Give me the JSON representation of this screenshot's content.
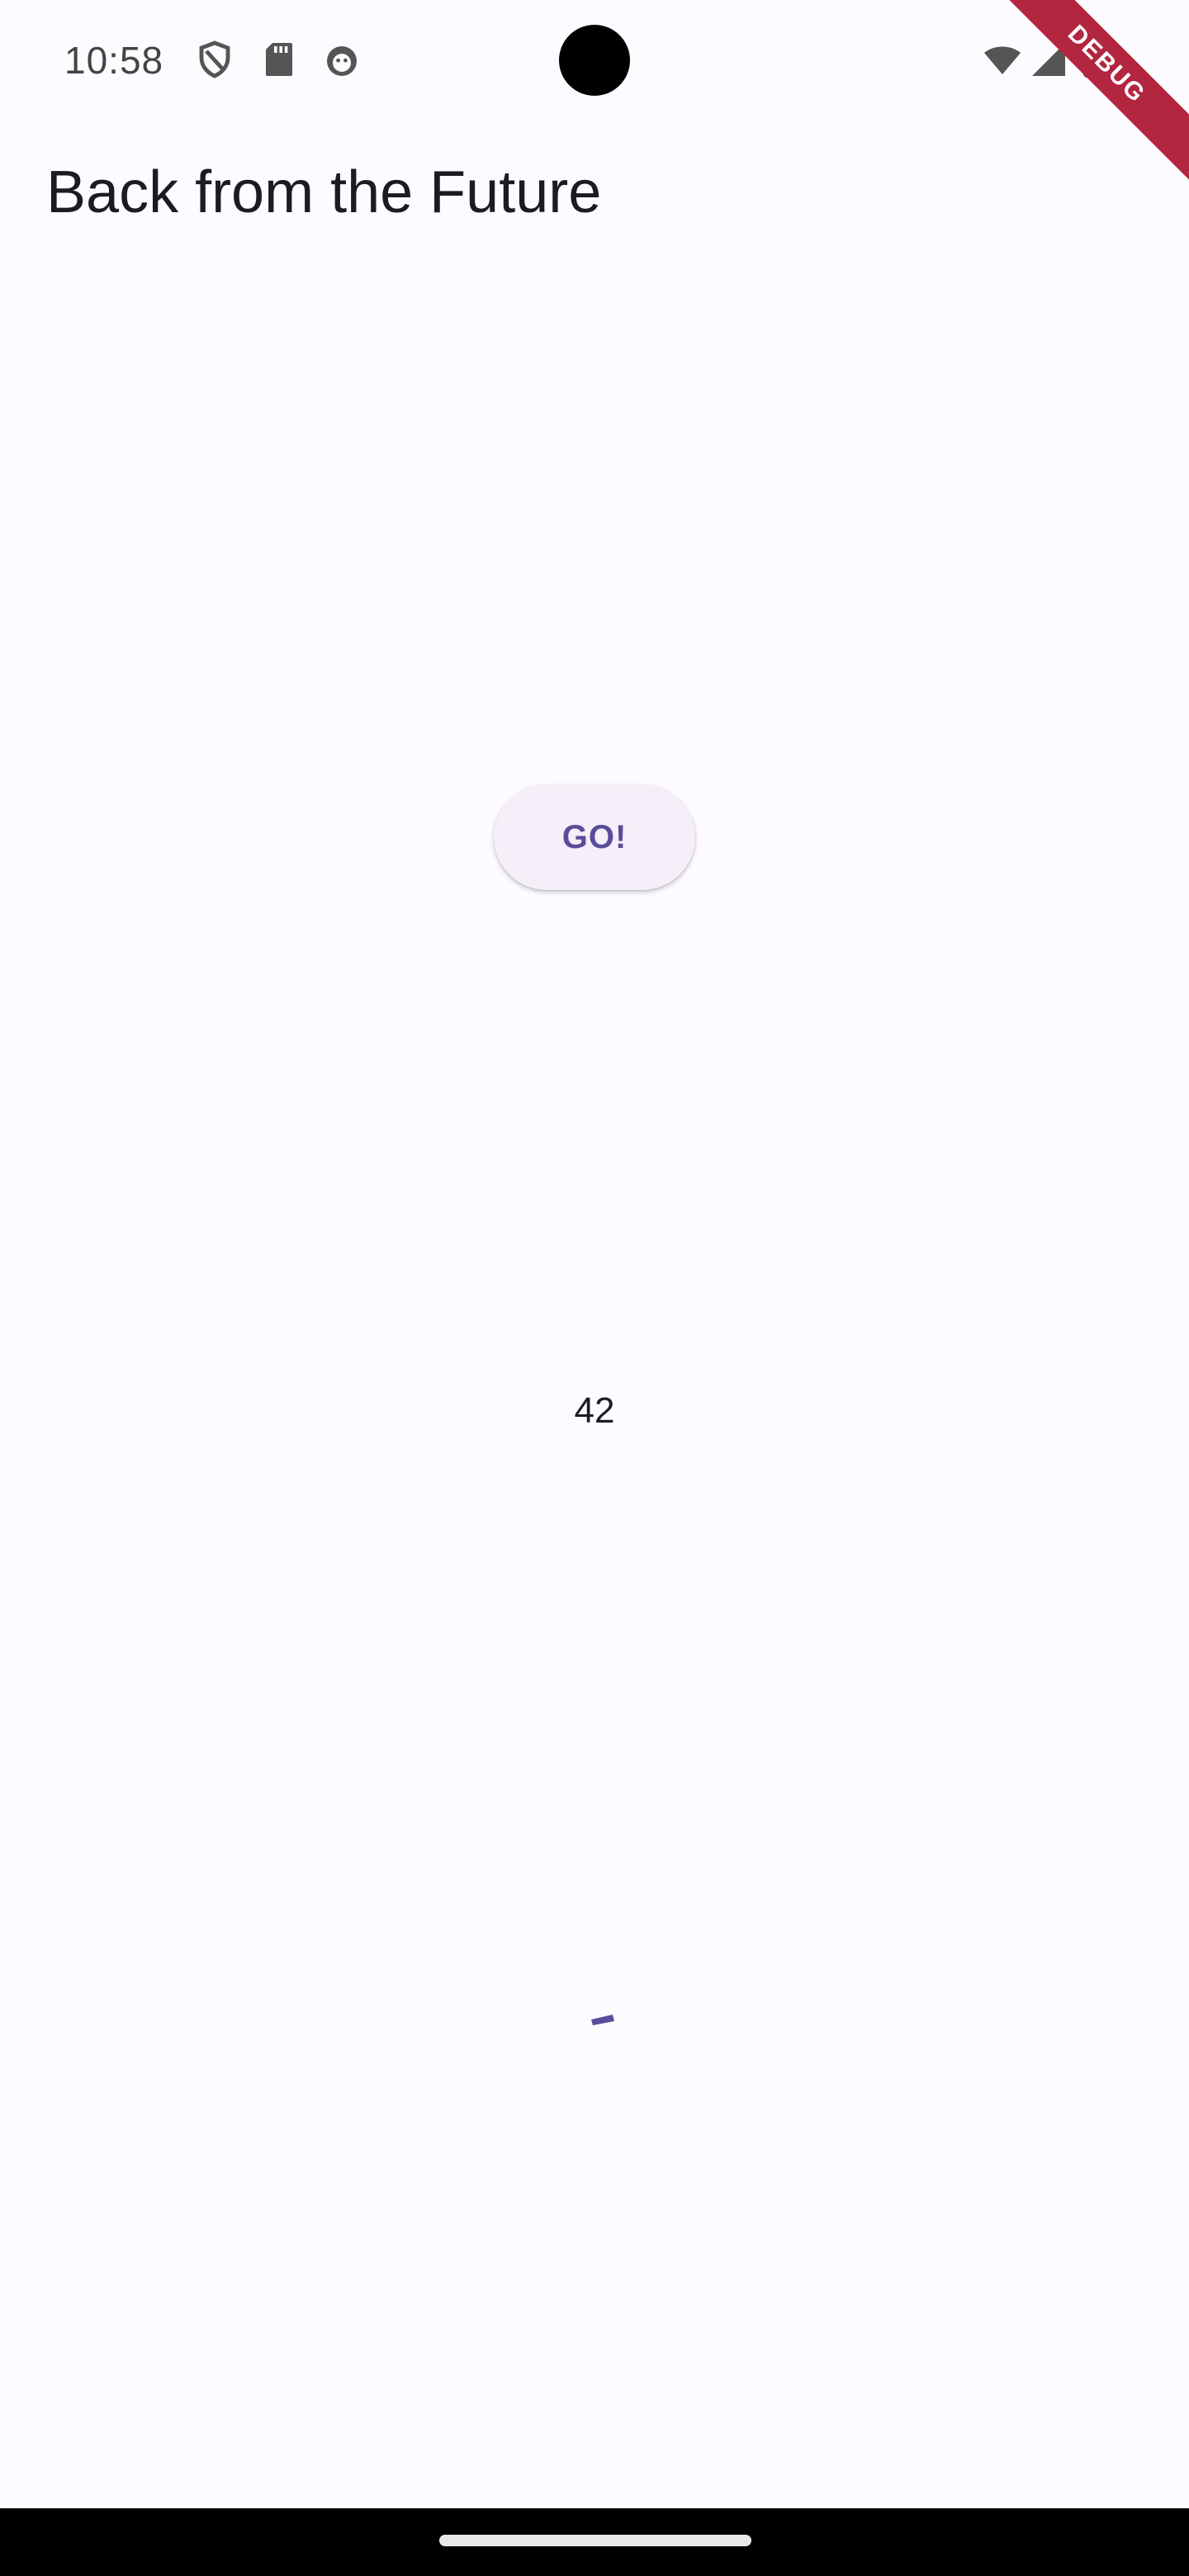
{
  "status_bar": {
    "time": "10:58",
    "icons_left": [
      "shield-icon",
      "sd-card-icon",
      "android-debug-icon"
    ],
    "icons_right": [
      "wifi-icon",
      "cell-signal-icon",
      "battery-icon"
    ]
  },
  "debug_banner": {
    "label": "DEBUG",
    "color": "#b3263f"
  },
  "app_bar": {
    "title": "Back from the Future"
  },
  "main": {
    "go_button_label": "GO!",
    "result_value": "42",
    "accent_color": "#5a4c9a"
  }
}
